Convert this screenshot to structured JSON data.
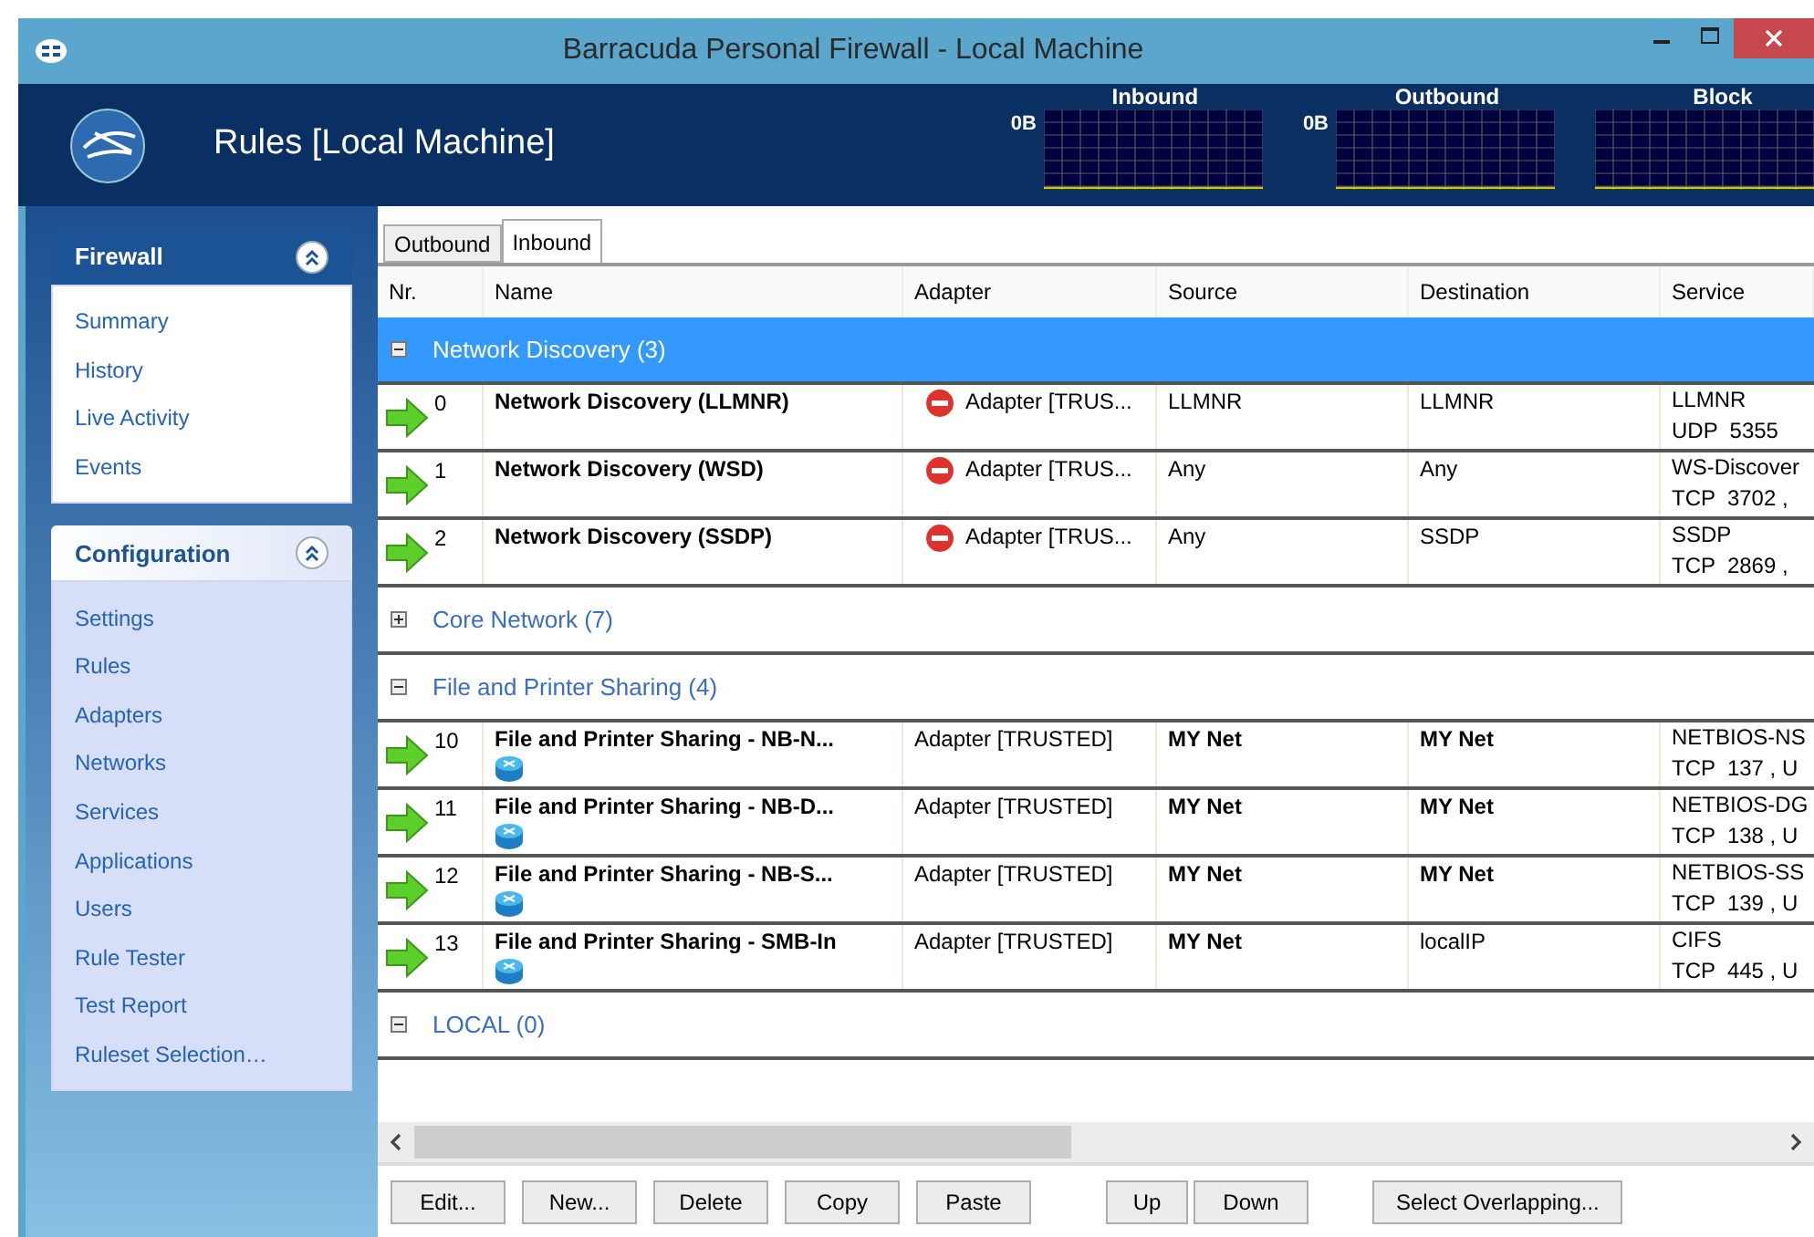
{
  "window": {
    "title": "Barracuda Personal Firewall - Local Machine"
  },
  "header": {
    "title": "Rules [Local Machine]",
    "meters": [
      {
        "label": "Inbound",
        "reading": "0B"
      },
      {
        "label": "Outbound",
        "reading": "0B"
      },
      {
        "label": "Block"
      }
    ]
  },
  "sidebar": {
    "panels": [
      {
        "title": "Firewall",
        "kind": "primary",
        "expanded": true,
        "items": [
          "Summary",
          "History",
          "Live Activity",
          "Events"
        ]
      },
      {
        "title": "Configuration",
        "kind": "secondary",
        "expanded": true,
        "items": [
          "Settings",
          "Rules",
          "Adapters",
          "Networks",
          "Services",
          "Applications",
          "Users",
          "Rule Tester",
          "Test Report",
          "Ruleset Selection…"
        ]
      }
    ]
  },
  "tabs": [
    {
      "label": "Outbound",
      "selected": false
    },
    {
      "label": "Inbound",
      "selected": true
    }
  ],
  "table": {
    "columns": [
      "Nr.",
      "Name",
      "Adapter",
      "Source",
      "Destination",
      "Service"
    ],
    "rows": [
      {
        "kind": "group",
        "label": "Network Discovery (3)",
        "expanded": true,
        "selected": true
      },
      {
        "kind": "rule",
        "nr": "0",
        "name": "Network Discovery (LLMNR)",
        "app_icon": false,
        "adapter": "Adapter [TRUS...",
        "adapter_blocked": true,
        "source": "LLMNR",
        "source_ref": false,
        "destination": "LLMNR",
        "destination_ref": false,
        "service": [
          "LLMNR",
          "UDP  5355"
        ]
      },
      {
        "kind": "rule",
        "nr": "1",
        "name": "Network Discovery (WSD)",
        "app_icon": false,
        "adapter": "Adapter [TRUS...",
        "adapter_blocked": true,
        "source": "Any",
        "source_ref": false,
        "destination": "Any",
        "destination_ref": false,
        "service": [
          "WS-Discover",
          "TCP  3702 ,"
        ]
      },
      {
        "kind": "rule",
        "nr": "2",
        "name": "Network Discovery (SSDP)",
        "app_icon": false,
        "adapter": "Adapter [TRUS...",
        "adapter_blocked": true,
        "source": "Any",
        "source_ref": false,
        "destination": "SSDP",
        "destination_ref": false,
        "service": [
          "SSDP",
          "TCP  2869 ,"
        ]
      },
      {
        "kind": "group",
        "label": "Core Network (7)",
        "expanded": false,
        "selected": false
      },
      {
        "kind": "group",
        "label": "File and Printer Sharing (4)",
        "expanded": true,
        "selected": false
      },
      {
        "kind": "rule",
        "nr": "10",
        "name": "File and Printer Sharing - NB-N...",
        "app_icon": true,
        "adapter": "Adapter [TRUSTED]",
        "adapter_blocked": false,
        "source": "MY Net",
        "source_ref": true,
        "destination": "MY Net",
        "destination_ref": true,
        "service": [
          "NETBIOS-NS",
          "TCP  137 , U"
        ]
      },
      {
        "kind": "rule",
        "nr": "11",
        "name": "File and Printer Sharing - NB-D...",
        "app_icon": true,
        "adapter": "Adapter [TRUSTED]",
        "adapter_blocked": false,
        "source": "MY Net",
        "source_ref": true,
        "destination": "MY Net",
        "destination_ref": true,
        "service": [
          "NETBIOS-DG",
          "TCP  138 , U"
        ]
      },
      {
        "kind": "rule",
        "nr": "12",
        "name": "File and Printer Sharing - NB-S...",
        "app_icon": true,
        "adapter": "Adapter [TRUSTED]",
        "adapter_blocked": false,
        "source": "MY Net",
        "source_ref": true,
        "destination": "MY Net",
        "destination_ref": true,
        "service": [
          "NETBIOS-SS",
          "TCP  139 , U"
        ]
      },
      {
        "kind": "rule",
        "nr": "13",
        "name": "File and Printer Sharing - SMB-In",
        "app_icon": true,
        "adapter": "Adapter [TRUSTED]",
        "adapter_blocked": false,
        "source": "MY Net",
        "source_ref": true,
        "destination": "localIP",
        "destination_ref": false,
        "service": [
          "CIFS",
          "TCP  445 , U"
        ]
      },
      {
        "kind": "group",
        "label": "LOCAL (0)",
        "expanded": true,
        "selected": false
      }
    ]
  },
  "buttons": [
    "Edit...",
    "New...",
    "Delete",
    "Copy",
    "Paste",
    "Up",
    "Down",
    "Select Overlapping..."
  ]
}
